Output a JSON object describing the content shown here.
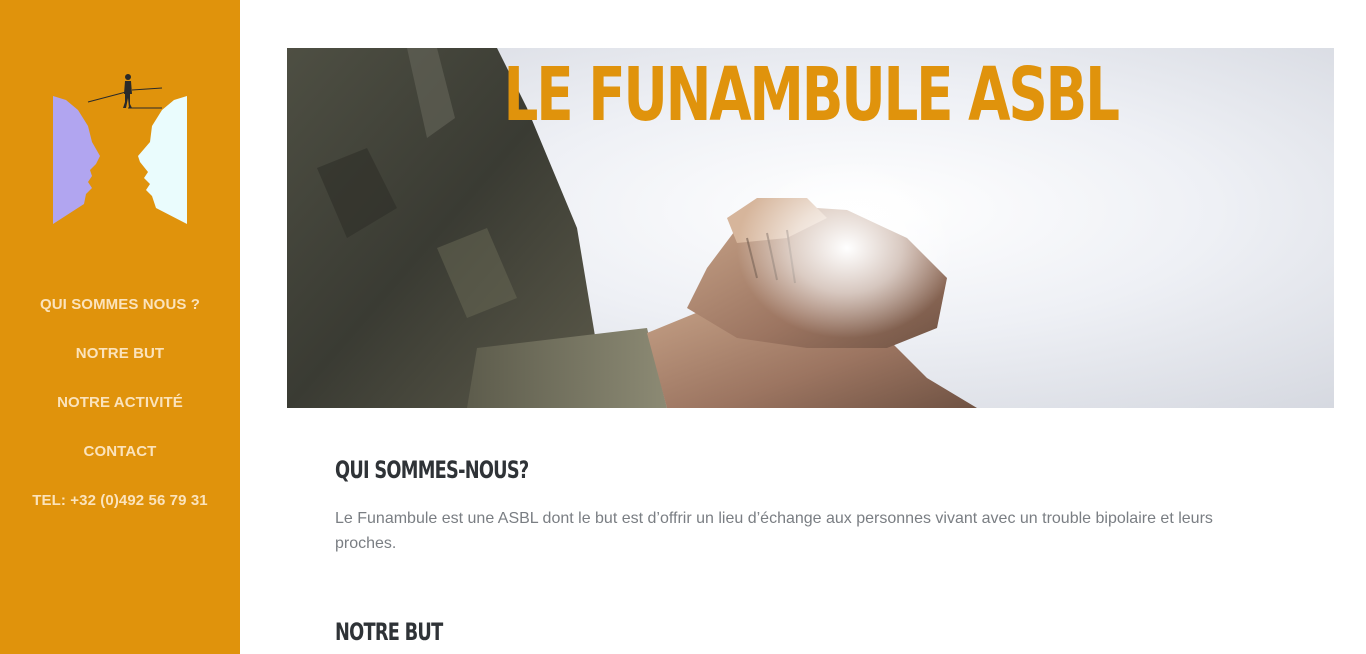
{
  "sidebar": {
    "logo_name": "funambule-logo",
    "background_color": "#e0930c",
    "nav": [
      {
        "label": "QUI SOMMES NOUS ?"
      },
      {
        "label": "NOTRE BUT"
      },
      {
        "label": "NOTRE ACTIVITÉ"
      },
      {
        "label": "CONTACT"
      }
    ],
    "phone": "TEL: +32 (0)492 56 79 31"
  },
  "hero": {
    "title": "LE FUNAMBULE ASBL",
    "title_color": "#e0930c",
    "image": "handshake-photo"
  },
  "sections": [
    {
      "heading": "QUI SOMMES-NOUS?",
      "text": "Le Funambule est une ASBL dont le but est d’offrir un lieu d’échange aux personnes vivant avec un trouble bipolaire et leurs proches."
    },
    {
      "heading": "NOTRE BUT"
    }
  ]
}
